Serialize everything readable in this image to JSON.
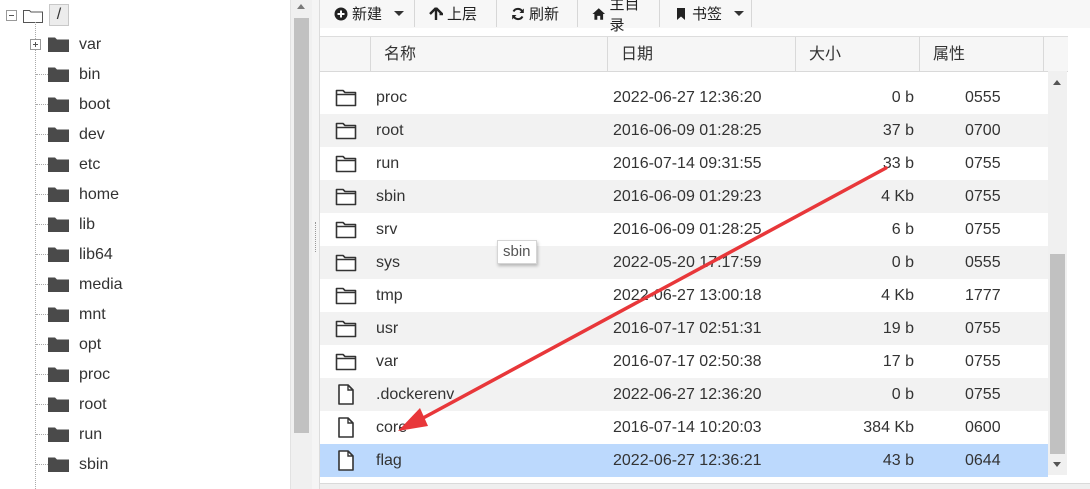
{
  "tree": {
    "root_label": "/",
    "items": [
      {
        "label": "var",
        "expandable": true
      },
      {
        "label": "bin",
        "expandable": false
      },
      {
        "label": "boot",
        "expandable": false
      },
      {
        "label": "dev",
        "expandable": false
      },
      {
        "label": "etc",
        "expandable": false
      },
      {
        "label": "home",
        "expandable": false
      },
      {
        "label": "lib",
        "expandable": false
      },
      {
        "label": "lib64",
        "expandable": false
      },
      {
        "label": "media",
        "expandable": false
      },
      {
        "label": "mnt",
        "expandable": false
      },
      {
        "label": "opt",
        "expandable": false
      },
      {
        "label": "proc",
        "expandable": false
      },
      {
        "label": "root",
        "expandable": false
      },
      {
        "label": "run",
        "expandable": false
      },
      {
        "label": "sbin",
        "expandable": false
      }
    ]
  },
  "toolbar": {
    "new_label": "新建",
    "up_label": "上层",
    "refresh_label": "刷新",
    "home_label": "主目录",
    "bookmark_label": "书签"
  },
  "grid": {
    "columns": {
      "name": "名称",
      "date": "日期",
      "size": "大小",
      "attr": "属性"
    },
    "rows": [
      {
        "type": "folder",
        "name": "proc",
        "date": "2022-06-27 12:36:20",
        "size": "0 b",
        "attr": "0555"
      },
      {
        "type": "folder",
        "name": "root",
        "date": "2016-06-09 01:28:25",
        "size": "37 b",
        "attr": "0700"
      },
      {
        "type": "folder",
        "name": "run",
        "date": "2016-07-14 09:31:55",
        "size": "33 b",
        "attr": "0755"
      },
      {
        "type": "folder",
        "name": "sbin",
        "date": "2016-06-09 01:29:23",
        "size": "4 Kb",
        "attr": "0755"
      },
      {
        "type": "folder",
        "name": "srv",
        "date": "2016-06-09 01:28:25",
        "size": "6 b",
        "attr": "0755"
      },
      {
        "type": "folder",
        "name": "sys",
        "date": "2022-05-20 17:17:59",
        "size": "0 b",
        "attr": "0555"
      },
      {
        "type": "folder",
        "name": "tmp",
        "date": "2022-06-27 13:00:18",
        "size": "4 Kb",
        "attr": "1777"
      },
      {
        "type": "folder",
        "name": "usr",
        "date": "2016-07-17 02:51:31",
        "size": "19 b",
        "attr": "0755"
      },
      {
        "type": "folder",
        "name": "var",
        "date": "2016-07-17 02:50:38",
        "size": "17 b",
        "attr": "0755"
      },
      {
        "type": "file",
        "name": ".dockerenv",
        "date": "2022-06-27 12:36:20",
        "size": "0 b",
        "attr": "0755"
      },
      {
        "type": "file",
        "name": "core",
        "date": "2016-07-14 10:20:03",
        "size": "384 Kb",
        "attr": "0600"
      },
      {
        "type": "file",
        "name": "flag",
        "date": "2022-06-27 12:36:21",
        "size": "43 b",
        "attr": "0644",
        "selected": true
      }
    ]
  },
  "tooltip": "sbin",
  "colors": {
    "selected_row": "#bcd9fd",
    "alt_row": "#f2f2f2",
    "annotation_arrow": "#e8373a",
    "folder_dark": "#4a4a4a"
  }
}
